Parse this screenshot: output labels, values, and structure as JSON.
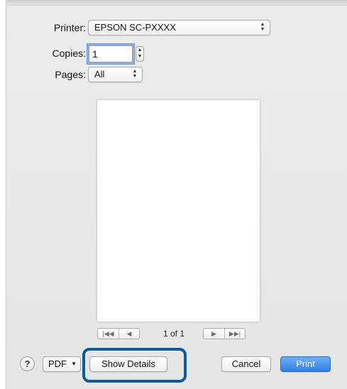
{
  "printer": {
    "label": "Printer:",
    "value": "EPSON SC-PXXXX"
  },
  "copies": {
    "label": "Copies:",
    "value": "1"
  },
  "pages": {
    "label": "Pages:",
    "value": "All"
  },
  "pagination": {
    "first": "|◀◀",
    "prev": "◀",
    "info": "1 of 1",
    "next": "▶",
    "last": "▶▶|"
  },
  "footer": {
    "help": "?",
    "pdf": "PDF",
    "show_details": "Show Details",
    "cancel": "Cancel",
    "print": "Print"
  },
  "colors": {
    "accent": "#2f7fe6",
    "highlight": "#0a5d96"
  }
}
